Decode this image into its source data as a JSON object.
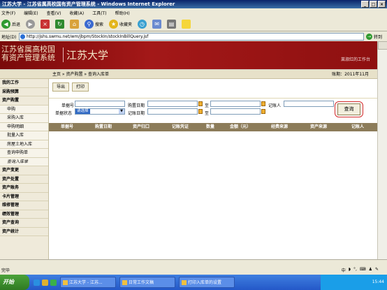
{
  "window": {
    "title": "江苏大学 - 江苏省属高校国有资产管理系统 - Windows Internet Explorer"
  },
  "menu": [
    "文件(F)",
    "编辑(E)",
    "查看(V)",
    "收藏(A)",
    "工具(T)",
    "帮助(H)"
  ],
  "toolbar": {
    "back": "后退",
    "search": "搜索",
    "favorites": "收藏夹"
  },
  "address": {
    "url": "http://jshs.swmu.net/wm/jbpm/StockIn/stockInBillQuery.jsf",
    "go": "转到"
  },
  "banner": {
    "logo_line1": "江苏省属高校国",
    "logo_line2": "有资产管理系统",
    "university": "江苏大学",
    "user": "莱淑红的工作台"
  },
  "breadcrumb": "主页 » 资产购置 » 查询入库单",
  "period": "账期：2011年11月",
  "sidebar": [
    {
      "label": "我的工作",
      "sub": false
    },
    {
      "label": "采购预算",
      "sub": false
    },
    {
      "label": "资产购置",
      "sub": false
    },
    {
      "label": "申购",
      "sub": true
    },
    {
      "label": "采购入库",
      "sub": true
    },
    {
      "label": "申购明细",
      "sub": true
    },
    {
      "label": "批量入库",
      "sub": true
    },
    {
      "label": "房屋土地入库",
      "sub": true
    },
    {
      "label": "查询申购单",
      "sub": true
    },
    {
      "label": "查询入库单",
      "sub": true,
      "active": true
    },
    {
      "label": "资产变更",
      "sub": false
    },
    {
      "label": "资产处置",
      "sub": false
    },
    {
      "label": "资产账务",
      "sub": false
    },
    {
      "label": "卡片管理",
      "sub": false
    },
    {
      "label": "维修管理",
      "sub": false
    },
    {
      "label": "绩效管理",
      "sub": false
    },
    {
      "label": "资产查询",
      "sub": false
    },
    {
      "label": "资产统计",
      "sub": false
    }
  ],
  "actions": {
    "export": "导出",
    "print": "打印"
  },
  "form": {
    "bill_no": "单据号",
    "buy_date": "购置日期",
    "to": "至",
    "recorder": "记账人",
    "status": "单据状态",
    "status_value": "请选择",
    "record_date": "记账日期",
    "query": "查询"
  },
  "table_headers": [
    "单据号",
    "购置日期",
    "资产归口",
    "记账凭证",
    "数量",
    "金额（元）",
    "经费来源",
    "资产来源",
    "记账人"
  ],
  "status": {
    "done": "完毕"
  },
  "taskbar": {
    "start": "开始",
    "tasks": [
      "江苏大学 - 江苏...",
      "日常工作文稿",
      "打印入库单的设置"
    ],
    "time": "15:44"
  }
}
